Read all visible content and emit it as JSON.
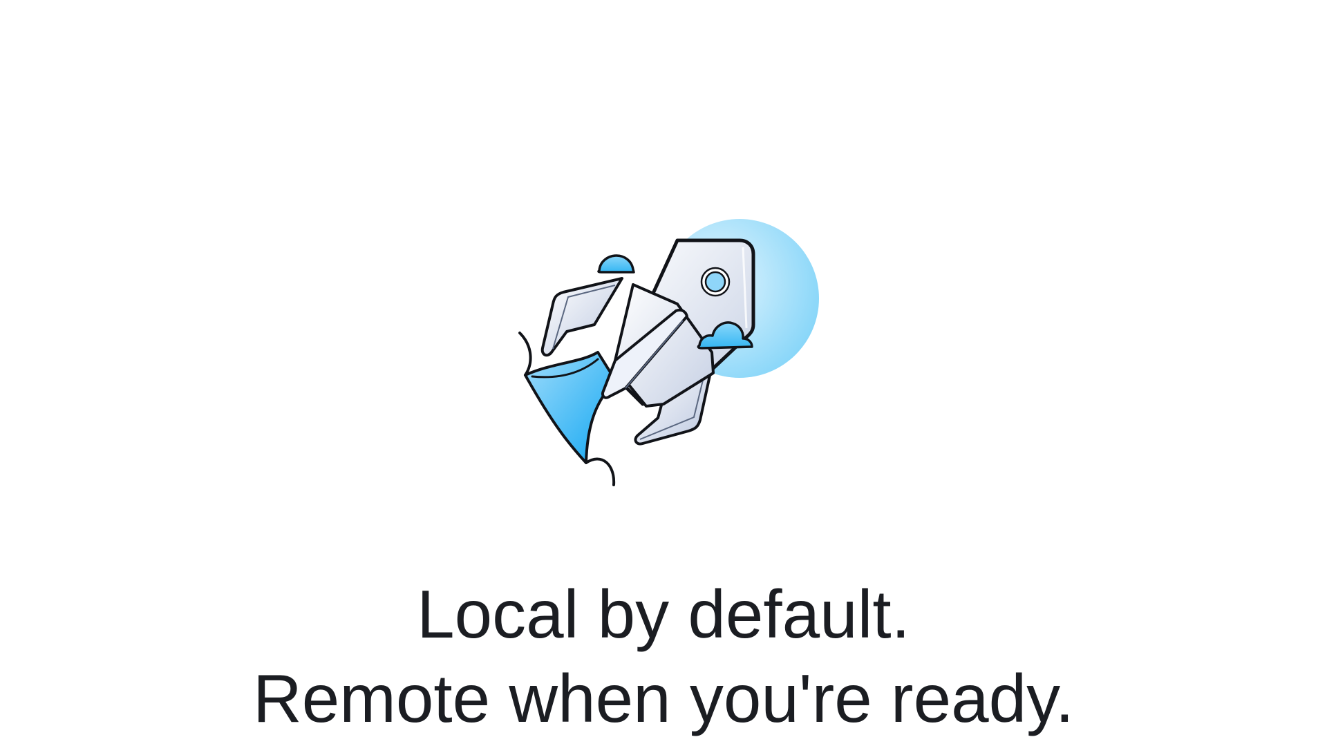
{
  "illustration": {
    "icon": "rocket-launch-icon",
    "colors": {
      "stroke": "#111318",
      "sky_blue": "#4cc1f5",
      "light_blue": "#bfe7fb",
      "body_highlight": "#ffffff",
      "body_shade": "#c9d3e6"
    }
  },
  "headline": {
    "line1": "Local by default.",
    "line2": "Remote when you're ready."
  },
  "colors": {
    "background": "#ffffff",
    "text": "#1b1d22"
  }
}
